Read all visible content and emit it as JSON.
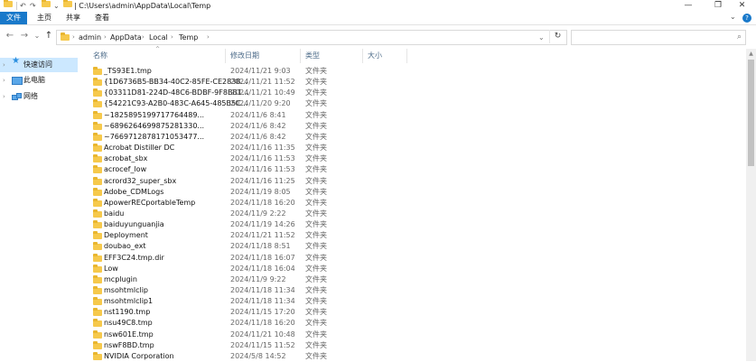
{
  "window": {
    "title": "| C:\\Users\\admin\\AppData\\Local\\Temp",
    "controls": {
      "minimize": "—",
      "maximize": "❐",
      "close": "✕"
    }
  },
  "ribbon": {
    "tabs": [
      {
        "label": "文件",
        "active": true
      },
      {
        "label": "主页",
        "active": false
      },
      {
        "label": "共享",
        "active": false
      },
      {
        "label": "查看",
        "active": false
      }
    ]
  },
  "nav": {
    "back": "←",
    "forward": "→",
    "recent": "⌄",
    "up": "↑",
    "breadcrumb": [
      "admin",
      "AppData",
      "Local",
      "Temp"
    ],
    "dropdown": "⌄",
    "refresh": "↻",
    "search_placeholder": ""
  },
  "leftpane": {
    "items": [
      {
        "label": "快速访问",
        "icon": "star-icon",
        "selected": true
      },
      {
        "label": "此电脑",
        "icon": "computer-icon",
        "selected": false
      },
      {
        "label": "网络",
        "icon": "network-icon",
        "selected": false
      }
    ]
  },
  "columns": {
    "name": "名称",
    "date": "修改日期",
    "type": "类型",
    "size": "大小"
  },
  "files": [
    {
      "name": "_TS93E1.tmp",
      "date": "2024/11/21 9:03",
      "type": "文件夹"
    },
    {
      "name": "{1D6736B5-BB34-40C2-85FE-CE2838...",
      "date": "2024/11/21 11:52",
      "type": "文件夹"
    },
    {
      "name": "{03311D81-224D-48C6-BDBF-9F8BB1...",
      "date": "2024/11/21 10:49",
      "type": "文件夹"
    },
    {
      "name": "{54221C93-A2B0-483C-A645-485B5C...",
      "date": "2024/11/20 9:20",
      "type": "文件夹"
    },
    {
      "name": "~1825895199717764489...",
      "date": "2024/11/6 8:41",
      "type": "文件夹"
    },
    {
      "name": "~6896264699875281330...",
      "date": "2024/11/6 8:42",
      "type": "文件夹"
    },
    {
      "name": "~7669712878171053477...",
      "date": "2024/11/6 8:42",
      "type": "文件夹"
    },
    {
      "name": "Acrobat Distiller DC",
      "date": "2024/11/16 11:35",
      "type": "文件夹"
    },
    {
      "name": "acrobat_sbx",
      "date": "2024/11/16 11:53",
      "type": "文件夹"
    },
    {
      "name": "acrocef_low",
      "date": "2024/11/16 11:53",
      "type": "文件夹"
    },
    {
      "name": "acrord32_super_sbx",
      "date": "2024/11/16 11:25",
      "type": "文件夹"
    },
    {
      "name": "Adobe_CDMLogs",
      "date": "2024/11/19 8:05",
      "type": "文件夹"
    },
    {
      "name": "ApowerRECportableTemp",
      "date": "2024/11/18 16:20",
      "type": "文件夹"
    },
    {
      "name": "baidu",
      "date": "2024/11/9 2:22",
      "type": "文件夹"
    },
    {
      "name": "baiduyunguanjia",
      "date": "2024/11/19 14:26",
      "type": "文件夹"
    },
    {
      "name": "Deployment",
      "date": "2024/11/21 11:52",
      "type": "文件夹"
    },
    {
      "name": "doubao_ext",
      "date": "2024/11/18 8:51",
      "type": "文件夹"
    },
    {
      "name": "EFF3C24.tmp.dir",
      "date": "2024/11/18 16:07",
      "type": "文件夹"
    },
    {
      "name": "Low",
      "date": "2024/11/18 16:04",
      "type": "文件夹"
    },
    {
      "name": "mcplugin",
      "date": "2024/11/9 9:22",
      "type": "文件夹"
    },
    {
      "name": "msohtmlclip",
      "date": "2024/11/18 11:34",
      "type": "文件夹"
    },
    {
      "name": "msohtmlclip1",
      "date": "2024/11/18 11:34",
      "type": "文件夹"
    },
    {
      "name": "nst1190.tmp",
      "date": "2024/11/15 17:20",
      "type": "文件夹"
    },
    {
      "name": "nsu49C8.tmp",
      "date": "2024/11/18 16:20",
      "type": "文件夹"
    },
    {
      "name": "nsw601E.tmp",
      "date": "2024/11/21 10:48",
      "type": "文件夹"
    },
    {
      "name": "nswF8BD.tmp",
      "date": "2024/11/15 11:52",
      "type": "文件夹"
    },
    {
      "name": "NVIDIA Corporation",
      "date": "2024/5/8 14:52",
      "type": "文件夹"
    }
  ],
  "colors": {
    "accent": "#1979ca",
    "selected": "#cce8ff",
    "folder": "#f6c94c",
    "header_text": "#4b6a88"
  }
}
